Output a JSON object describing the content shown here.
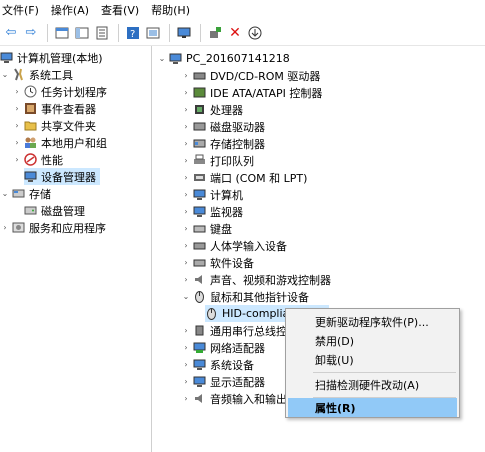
{
  "menubar": {
    "items": [
      "文件(F)",
      "操作(A)",
      "查看(V)",
      "帮助(H)"
    ]
  },
  "toolbar": {
    "buttons": [
      "back-icon",
      "forward-icon",
      "up-icon",
      "show-tree-icon",
      "properties-icon",
      "help-icon",
      "refresh-icon",
      "monitor-icon",
      "add-driver-icon",
      "uninstall-icon",
      "download-icon"
    ]
  },
  "left_tree": {
    "items": [
      "计算机管理(本地)",
      "系统工具",
      "任务计划程序",
      "事件查看器",
      "共享文件夹",
      "本地用户和组",
      "性能",
      "设备管理器",
      "存储",
      "磁盘管理",
      "服务和应用程序"
    ]
  },
  "device_tree": {
    "root": "PC_201607141218",
    "items": [
      "DVD/CD-ROM 驱动器",
      "IDE ATA/ATAPI 控制器",
      "处理器",
      "磁盘驱动器",
      "存储控制器",
      "打印队列",
      "端口 (COM 和 LPT)",
      "计算机",
      "监视器",
      "键盘",
      "人体学输入设备",
      "软件设备",
      "声音、视频和游戏控制器",
      "鼠标和其他指针设备",
      "HID-compliant mouse",
      "通用串行总线控制",
      "网络适配器",
      "系统设备",
      "显示适配器",
      "音频输入和输出"
    ]
  },
  "context_menu": {
    "items": [
      "更新驱动程序软件(P)...",
      "禁用(D)",
      "卸载(U)",
      "扫描检测硬件改动(A)",
      "属性(R)"
    ]
  },
  "colors": {
    "selection": "#cce8ff",
    "menu_highlight": "#91c9f7",
    "menu_bg": "#f2f2f2"
  }
}
